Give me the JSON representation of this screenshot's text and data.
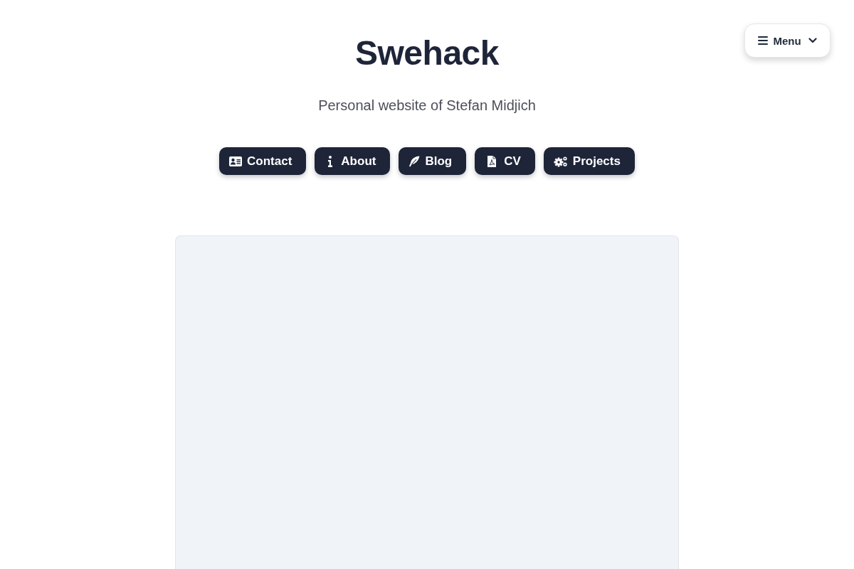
{
  "menu_button": {
    "label": "Menu",
    "expanded": false
  },
  "header": {
    "title": "Swehack",
    "subtitle": "Personal website of Stefan Midjich"
  },
  "nav_buttons": [
    "Contact",
    "About",
    "Blog",
    "CV",
    "Projects"
  ]
}
